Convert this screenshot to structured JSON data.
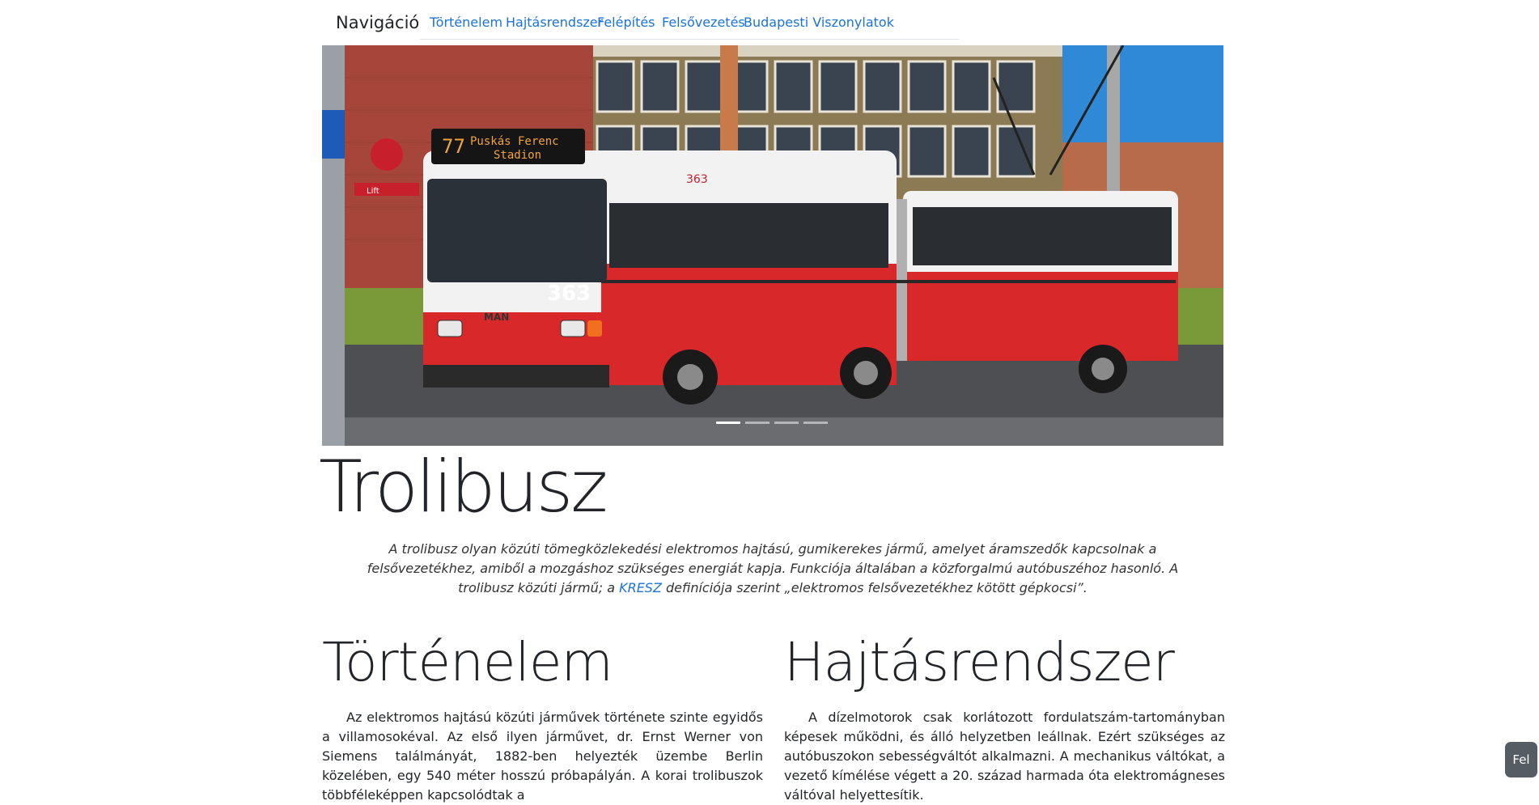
{
  "nav": {
    "brand": "Navigáció",
    "tabs": [
      "Történelem",
      "Hajtásrendszer",
      "Felépítés",
      "Felsővezetés",
      "Budapesti Viszonylatok"
    ]
  },
  "carousel": {
    "slide_count": 4,
    "active_index": 0,
    "bus": {
      "destination_line1": "Puskás Ferenc",
      "destination_line2": "Stadion",
      "route": "77",
      "fleet_number": "363",
      "maker": "MAN",
      "stop_sign_text": "Lift"
    }
  },
  "hero": {
    "title": "Trolibusz",
    "lead_before": "A trolibusz olyan közúti tömegközlekedési elektromos hajtású, gumikerekes jármű, amelyet áramszedők kapcsolnak a felsővezetékhez, amiből a mozgáshoz szükséges energiát kapja. Funkciója általában a közforgalmú autóbuszéhoz hasonló. A trolibusz közúti jármű; a ",
    "lead_link": "KRESZ",
    "lead_after": " definíciója szerint „elektromos felsővezetékhez kötött gépkocsi”."
  },
  "sections": [
    {
      "heading": "Történelem",
      "text": "Az elektromos hajtású közúti járművek története szinte egyidős a villamosokéval. Az első ilyen járművet, dr. Ernst Werner von Siemens találmányát, 1882-ben helyezték üzembe Berlin közelében, egy 540 méter hosszú próbapályán. A korai trolibuszok többféleképpen kapcsolódtak a"
    },
    {
      "heading": "Hajtásrendszer",
      "text": "A dízelmotorok csak korlátozott fordulatszám-tartományban képesek működni, és álló helyzetben leállnak. Ezért szükséges az autóbuszokon sebességváltót alkalmazni. A mechanikus váltókat, a vezető kímélése végett a 20. század harmada óta elektromágneses váltóval helyettesítik."
    }
  ],
  "back_to_top": "Fel",
  "colors": {
    "link": "#1a73d9",
    "bus_red": "#d8282a",
    "bus_white": "#f2f2f2",
    "brick": "#a6463a",
    "sky": "#2f89d6"
  }
}
